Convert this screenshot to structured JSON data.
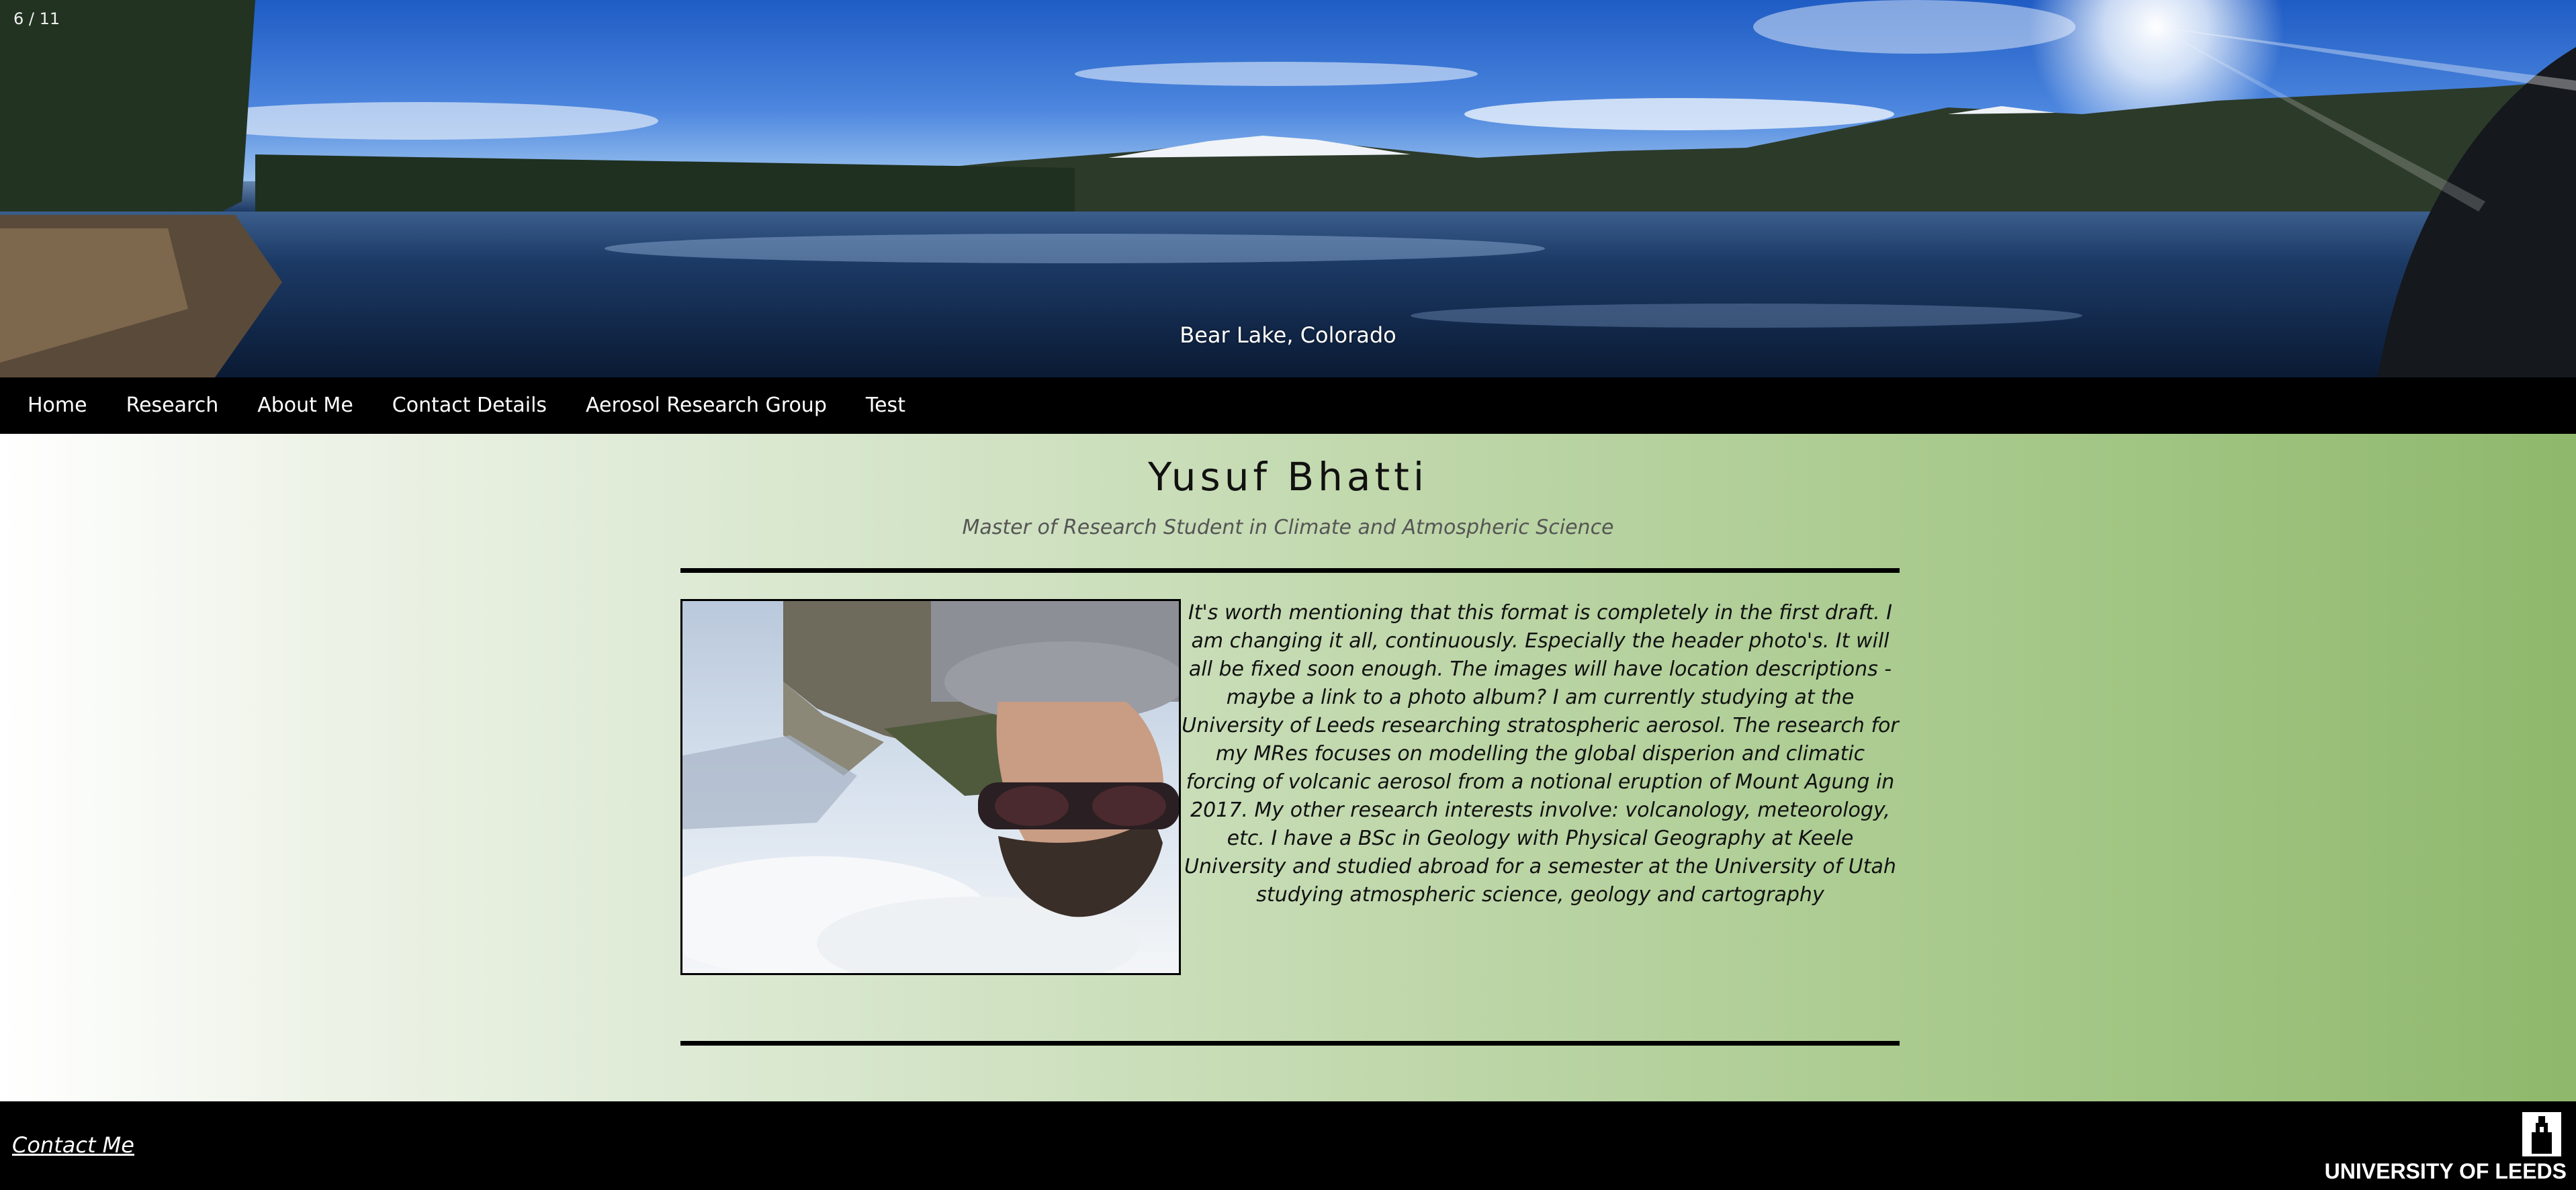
{
  "hero": {
    "counter": "6 / 11",
    "caption": "Bear Lake, Colorado"
  },
  "nav": {
    "items": [
      {
        "label": "Home"
      },
      {
        "label": "Research"
      },
      {
        "label": "About Me"
      },
      {
        "label": "Contact Details"
      },
      {
        "label": "Aerosol Research Group"
      },
      {
        "label": "Test"
      }
    ]
  },
  "main": {
    "title": "Yusuf Bhatti",
    "subtitle": "Master of Research Student in Climate and Atmospheric Science",
    "bio": "It's worth mentioning that this format is completely in the first draft. I am changing it all, continuously. Especially the header photo's. It will all be fixed soon enough. The images will have location descriptions - maybe a link to a photo album? I am currently studying at the University of Leeds researching stratospheric aerosol. The research for my MRes focuses on modelling the global disperion and climatic forcing of volcanic aerosol from a notional eruption of Mount Agung in 2017. My other research interests involve: volcanology, meteorology, etc. I have a BSc in Geology with Physical Geography at Keele University and studied abroad for a semester at the University of Utah studying atmospheric science, geology and cartography"
  },
  "footer": {
    "contact_label": "Contact Me",
    "logo_text": "UNIVERSITY OF LEEDS"
  },
  "colors": {
    "nav_bg": "#000000",
    "gradient_start": "#ffffff",
    "gradient_end": "#8fb86c",
    "rule": "#000000"
  }
}
